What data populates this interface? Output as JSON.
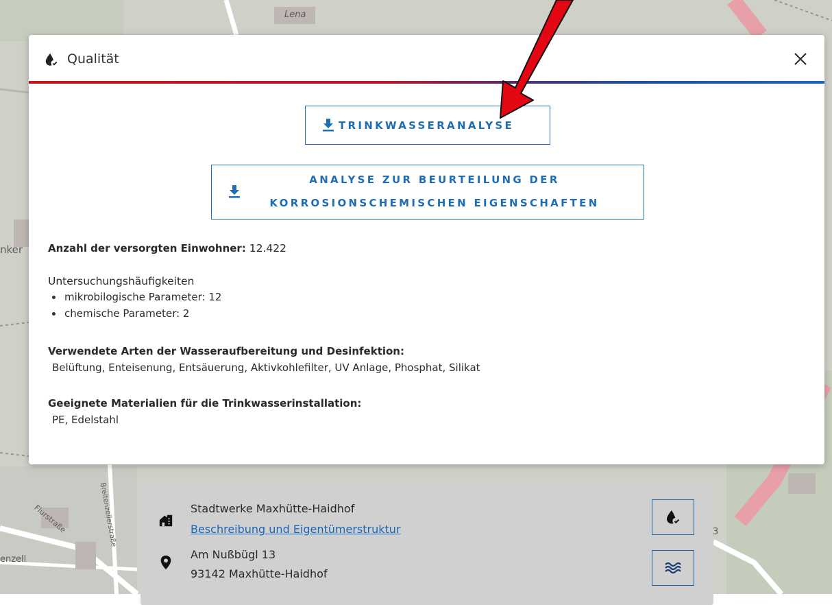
{
  "map": {
    "labels": [
      "Lena",
      "Flurstraße",
      "Breitenzeilerstraße",
      "nker",
      "enzell",
      "3"
    ]
  },
  "modal": {
    "title": "Qualität",
    "title_icon": "water-drop-check-icon",
    "close_icon": "close-icon",
    "buttons": {
      "trinkwasseranalyse": "TRINKWASSERANALYSE",
      "korrosion_line1": "ANALYSE ZUR BEURTEILUNG DER",
      "korrosion_line2": "KORROSIONSCHEMISCHEN EIGENSCHAFTEN"
    },
    "einwohner": {
      "label": "Anzahl der versorgten Einwohner:",
      "value": "12.422"
    },
    "untersuchung": {
      "heading": "Untersuchungshäufigkeiten",
      "items": [
        "mikrobilogische Parameter: 12",
        "chemische Parameter: 2"
      ]
    },
    "aufbereitung": {
      "heading": "Verwendete Arten der Wasseraufbereitung und Desinfektion:",
      "value": "Belüftung, Enteisenung, Entsäuerung, Aktivkohlefilter, UV Anlage, Phosphat, Silikat"
    },
    "materialien": {
      "heading": "Geeignete Materialien für die Trinkwasserinstallation:",
      "value": "PE, Edelstahl"
    }
  },
  "info_card": {
    "company": "Stadtwerke Maxhütte-Haidhof",
    "company_link": "Beschreibung und Eigentümerstruktur",
    "address_line1": "Am Nußbügl 13",
    "address_line2": "93142 Maxhütte-Haidhof"
  },
  "colors": {
    "accent_blue": "#1f6db3",
    "gradient_red": "#c0171e",
    "annotation_arrow": "#e30613"
  }
}
